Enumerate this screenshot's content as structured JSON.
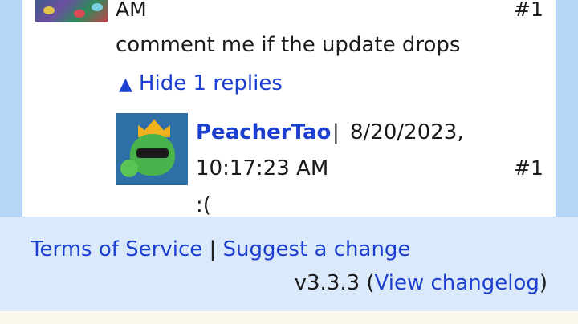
{
  "parent_comment": {
    "time_tail": "AM",
    "number": "#1",
    "text": "comment me if the update drops",
    "toggle_icon": "▲",
    "toggle_label": "Hide 1 replies"
  },
  "reply": {
    "username": "PeacherTao",
    "separator": "|",
    "date": "8/20/2023,",
    "time": "10:17:23 AM",
    "number": "#1",
    "text": ":("
  },
  "footer": {
    "terms_label": "Terms of Service",
    "separator": "|",
    "suggest_label": "Suggest a change",
    "version": "v3.3.3",
    "open_paren": "(",
    "changelog_label": "View changelog",
    "close_paren": ")"
  }
}
